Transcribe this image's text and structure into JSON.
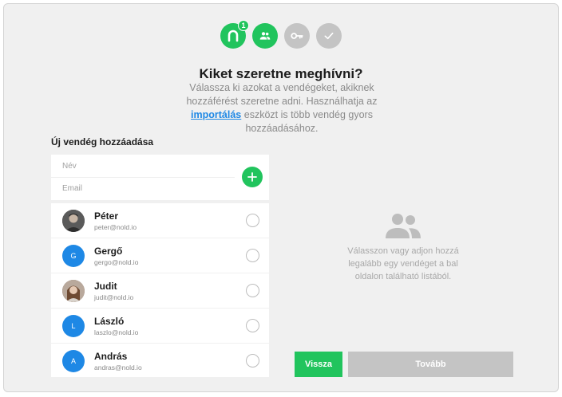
{
  "stepper": {
    "steps": [
      {
        "icon": "nold-logo-icon",
        "state": "active",
        "badge": "1"
      },
      {
        "icon": "people-icon",
        "state": "active"
      },
      {
        "icon": "key-icon",
        "state": "inactive"
      },
      {
        "icon": "check-icon",
        "state": "inactive"
      }
    ],
    "active_color": "#21c45d",
    "inactive_color": "#c4c4c4"
  },
  "header": {
    "title": "Kiket szeretne meghívni?",
    "subtitle_before": "Válassza ki azokat a vendégeket, akiknek hozzáférést szeretne adni. Használhatja az ",
    "subtitle_link": "importálás",
    "subtitle_after": " eszközt is több vendég gyors hozzáadásához."
  },
  "new_guest": {
    "label": "Új vendég hozzáadása",
    "name_placeholder": "Név",
    "email_placeholder": "Email",
    "add_icon": "plus-icon"
  },
  "guests": [
    {
      "name": "Péter",
      "email": "peter@nold.io",
      "avatar": "photo",
      "initial": ""
    },
    {
      "name": "Gergő",
      "email": "gergo@nold.io",
      "avatar": "initial",
      "initial": "G"
    },
    {
      "name": "Judit",
      "email": "judit@nold.io",
      "avatar": "photo",
      "initial": ""
    },
    {
      "name": "László",
      "email": "laszlo@nold.io",
      "avatar": "initial",
      "initial": "L"
    },
    {
      "name": "András",
      "email": "andras@nold.io",
      "avatar": "initial",
      "initial": "A"
    }
  ],
  "empty_state": {
    "icon": "people-icon",
    "text": "Válasszon vagy adjon hozzá legalább egy vendéget a bal oldalon található listából."
  },
  "buttons": {
    "back": "Vissza",
    "next": "Tovább"
  },
  "colors": {
    "accent": "#21c45d",
    "link": "#1e88e5",
    "avatar_blue": "#1e88e5",
    "disabled": "#c4c4c4"
  }
}
